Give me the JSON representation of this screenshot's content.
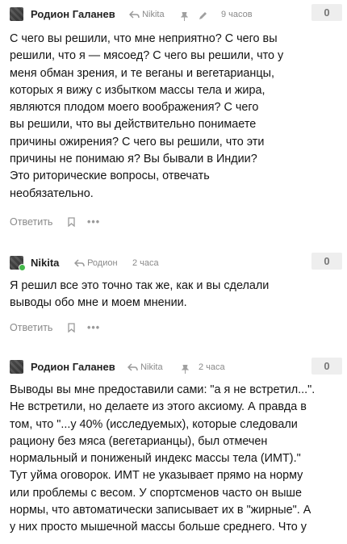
{
  "comments": [
    {
      "author": "Родион Галанев",
      "reply_to": "Nikita",
      "time": "9 часов",
      "votes": "0",
      "edited": true,
      "text": "С чего вы решили, что мне неприятно? С чего вы\nрешили, что я — мясоед? С чего вы решили, что у\nменя обман зрения, и те веганы и вегетарианцы,\nкоторых я вижу с избытком массы тела и жира,\nявляются плодом моего воображения? С чего\nвы решили, что вы действительно понимаете\nпричины ожирения? С чего вы решили, что эти\nпричины не понимаю я? Вы бывали в Индии?\nЭто риторические вопросы, отвечать\nнеобязательно.",
      "reply_label": "Ответить",
      "more_label": "•••"
    },
    {
      "author": "Nikita",
      "reply_to": "Родион",
      "time": "2 часа",
      "votes": "0",
      "text": "Я решил все это точно так же, как и вы сделали\nвыводы обо мне и моем мнении.",
      "reply_label": "Ответить",
      "more_label": "•••"
    },
    {
      "author": "Родион Галанев",
      "reply_to": "Nikita",
      "time": "2 часа",
      "votes": "0",
      "text": "Выводы вы мне предоставили сами: \"а я не встретил...\".\nНе встретили, но делаете из этого аксиому. А правда в\nтом, что \"...у 40% (исследуемых), которые следовали\nрациону без мяса (вегетарианцы), был отмечен\nнормальный и пониженый индекс массы тела (ИМТ).\"\nТут уйма оговорок. ИМТ не указывает прямо на норму\nили проблемы с весом. У спортсменов часто он выше\nнормы, что автоматически записывает их в \"жирные\". А\nу них просто мышечной массы больше среднего. Что у"
    }
  ],
  "colors": {
    "muted": "#8a8a8a",
    "vote_bg": "#eeeeee",
    "online": "#44b84a"
  },
  "icons": {
    "reply": "reply-arrow-icon",
    "bookmark": "bookmark-icon",
    "menu": "dots-icon",
    "pin": "pin-icon",
    "edit": "pencil-icon"
  }
}
